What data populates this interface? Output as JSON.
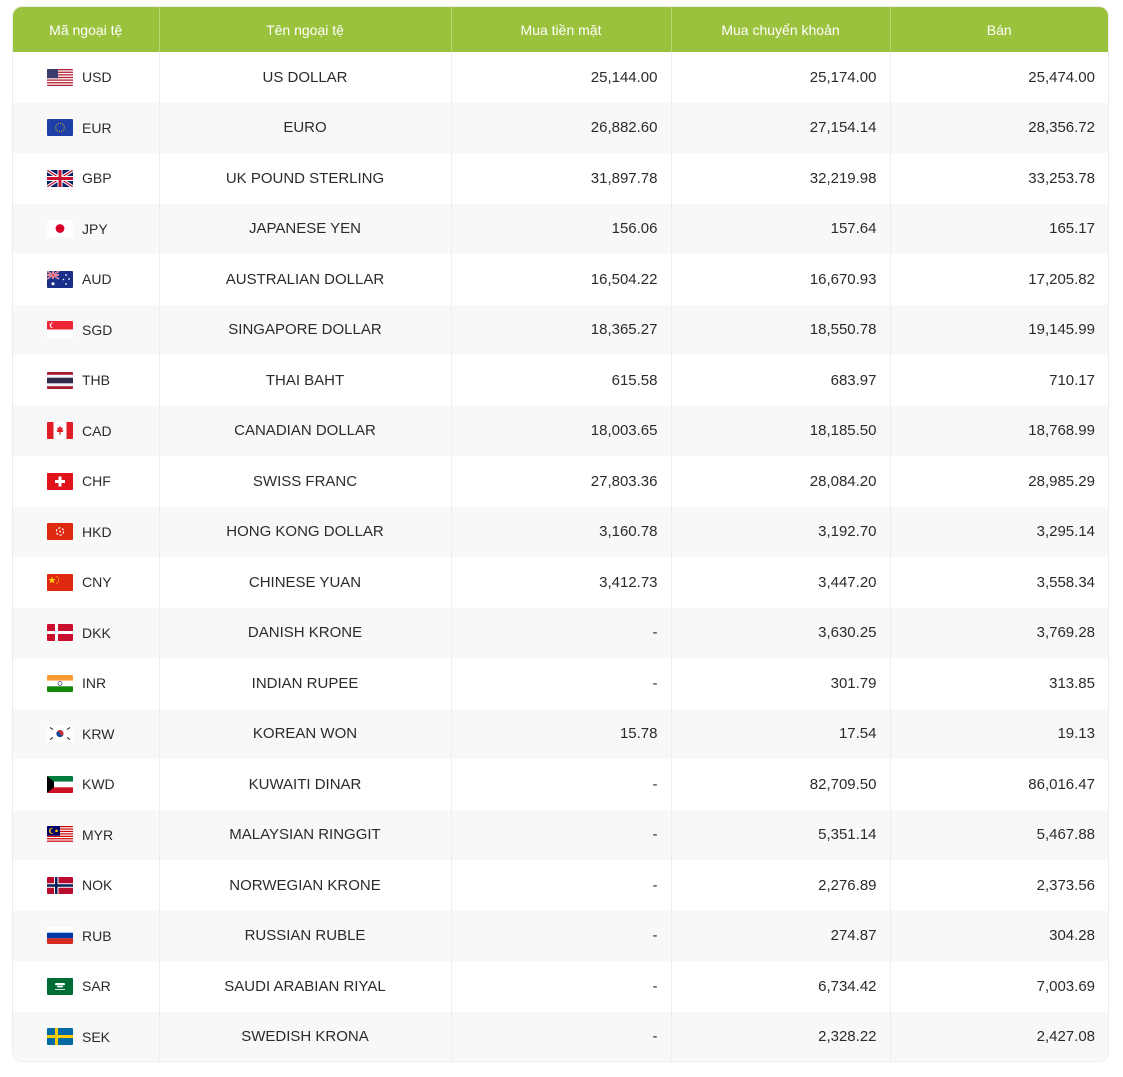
{
  "table": {
    "headers": [
      "Mã ngoại tệ",
      "Tên ngoại tệ",
      "Mua tiền mặt",
      "Mua chuyển khoản",
      "Bán"
    ],
    "rows": [
      {
        "flag": "us-flag-icon",
        "code": "USD",
        "name": "US DOLLAR",
        "cash": "25,144.00",
        "transfer": "25,174.00",
        "sell": "25,474.00"
      },
      {
        "flag": "eu-flag-icon",
        "code": "EUR",
        "name": "EURO",
        "cash": "26,882.60",
        "transfer": "27,154.14",
        "sell": "28,356.72"
      },
      {
        "flag": "gb-flag-icon",
        "code": "GBP",
        "name": "UK POUND STERLING",
        "cash": "31,897.78",
        "transfer": "32,219.98",
        "sell": "33,253.78"
      },
      {
        "flag": "jp-flag-icon",
        "code": "JPY",
        "name": "JAPANESE YEN",
        "cash": "156.06",
        "transfer": "157.64",
        "sell": "165.17"
      },
      {
        "flag": "au-flag-icon",
        "code": "AUD",
        "name": "AUSTRALIAN DOLLAR",
        "cash": "16,504.22",
        "transfer": "16,670.93",
        "sell": "17,205.82"
      },
      {
        "flag": "sg-flag-icon",
        "code": "SGD",
        "name": "SINGAPORE DOLLAR",
        "cash": "18,365.27",
        "transfer": "18,550.78",
        "sell": "19,145.99"
      },
      {
        "flag": "th-flag-icon",
        "code": "THB",
        "name": "THAI BAHT",
        "cash": "615.58",
        "transfer": "683.97",
        "sell": "710.17"
      },
      {
        "flag": "ca-flag-icon",
        "code": "CAD",
        "name": "CANADIAN DOLLAR",
        "cash": "18,003.65",
        "transfer": "18,185.50",
        "sell": "18,768.99"
      },
      {
        "flag": "ch-flag-icon",
        "code": "CHF",
        "name": "SWISS FRANC",
        "cash": "27,803.36",
        "transfer": "28,084.20",
        "sell": "28,985.29"
      },
      {
        "flag": "hk-flag-icon",
        "code": "HKD",
        "name": "HONG KONG DOLLAR",
        "cash": "3,160.78",
        "transfer": "3,192.70",
        "sell": "3,295.14"
      },
      {
        "flag": "cn-flag-icon",
        "code": "CNY",
        "name": "CHINESE YUAN",
        "cash": "3,412.73",
        "transfer": "3,447.20",
        "sell": "3,558.34"
      },
      {
        "flag": "dk-flag-icon",
        "code": "DKK",
        "name": "DANISH KRONE",
        "cash": "-",
        "transfer": "3,630.25",
        "sell": "3,769.28"
      },
      {
        "flag": "in-flag-icon",
        "code": "INR",
        "name": "INDIAN RUPEE",
        "cash": "-",
        "transfer": "301.79",
        "sell": "313.85"
      },
      {
        "flag": "kr-flag-icon",
        "code": "KRW",
        "name": "KOREAN WON",
        "cash": "15.78",
        "transfer": "17.54",
        "sell": "19.13"
      },
      {
        "flag": "kw-flag-icon",
        "code": "KWD",
        "name": "KUWAITI DINAR",
        "cash": "-",
        "transfer": "82,709.50",
        "sell": "86,016.47"
      },
      {
        "flag": "my-flag-icon",
        "code": "MYR",
        "name": "MALAYSIAN RINGGIT",
        "cash": "-",
        "transfer": "5,351.14",
        "sell": "5,467.88"
      },
      {
        "flag": "no-flag-icon",
        "code": "NOK",
        "name": "NORWEGIAN KRONE",
        "cash": "-",
        "transfer": "2,276.89",
        "sell": "2,373.56"
      },
      {
        "flag": "ru-flag-icon",
        "code": "RUB",
        "name": "RUSSIAN RUBLE",
        "cash": "-",
        "transfer": "274.87",
        "sell": "304.28"
      },
      {
        "flag": "sa-flag-icon",
        "code": "SAR",
        "name": "SAUDI ARABIAN RIYAL",
        "cash": "-",
        "transfer": "6,734.42",
        "sell": "7,003.69"
      },
      {
        "flag": "se-flag-icon",
        "code": "SEK",
        "name": "SWEDISH KRONA",
        "cash": "-",
        "transfer": "2,328.22",
        "sell": "2,427.08"
      }
    ]
  }
}
